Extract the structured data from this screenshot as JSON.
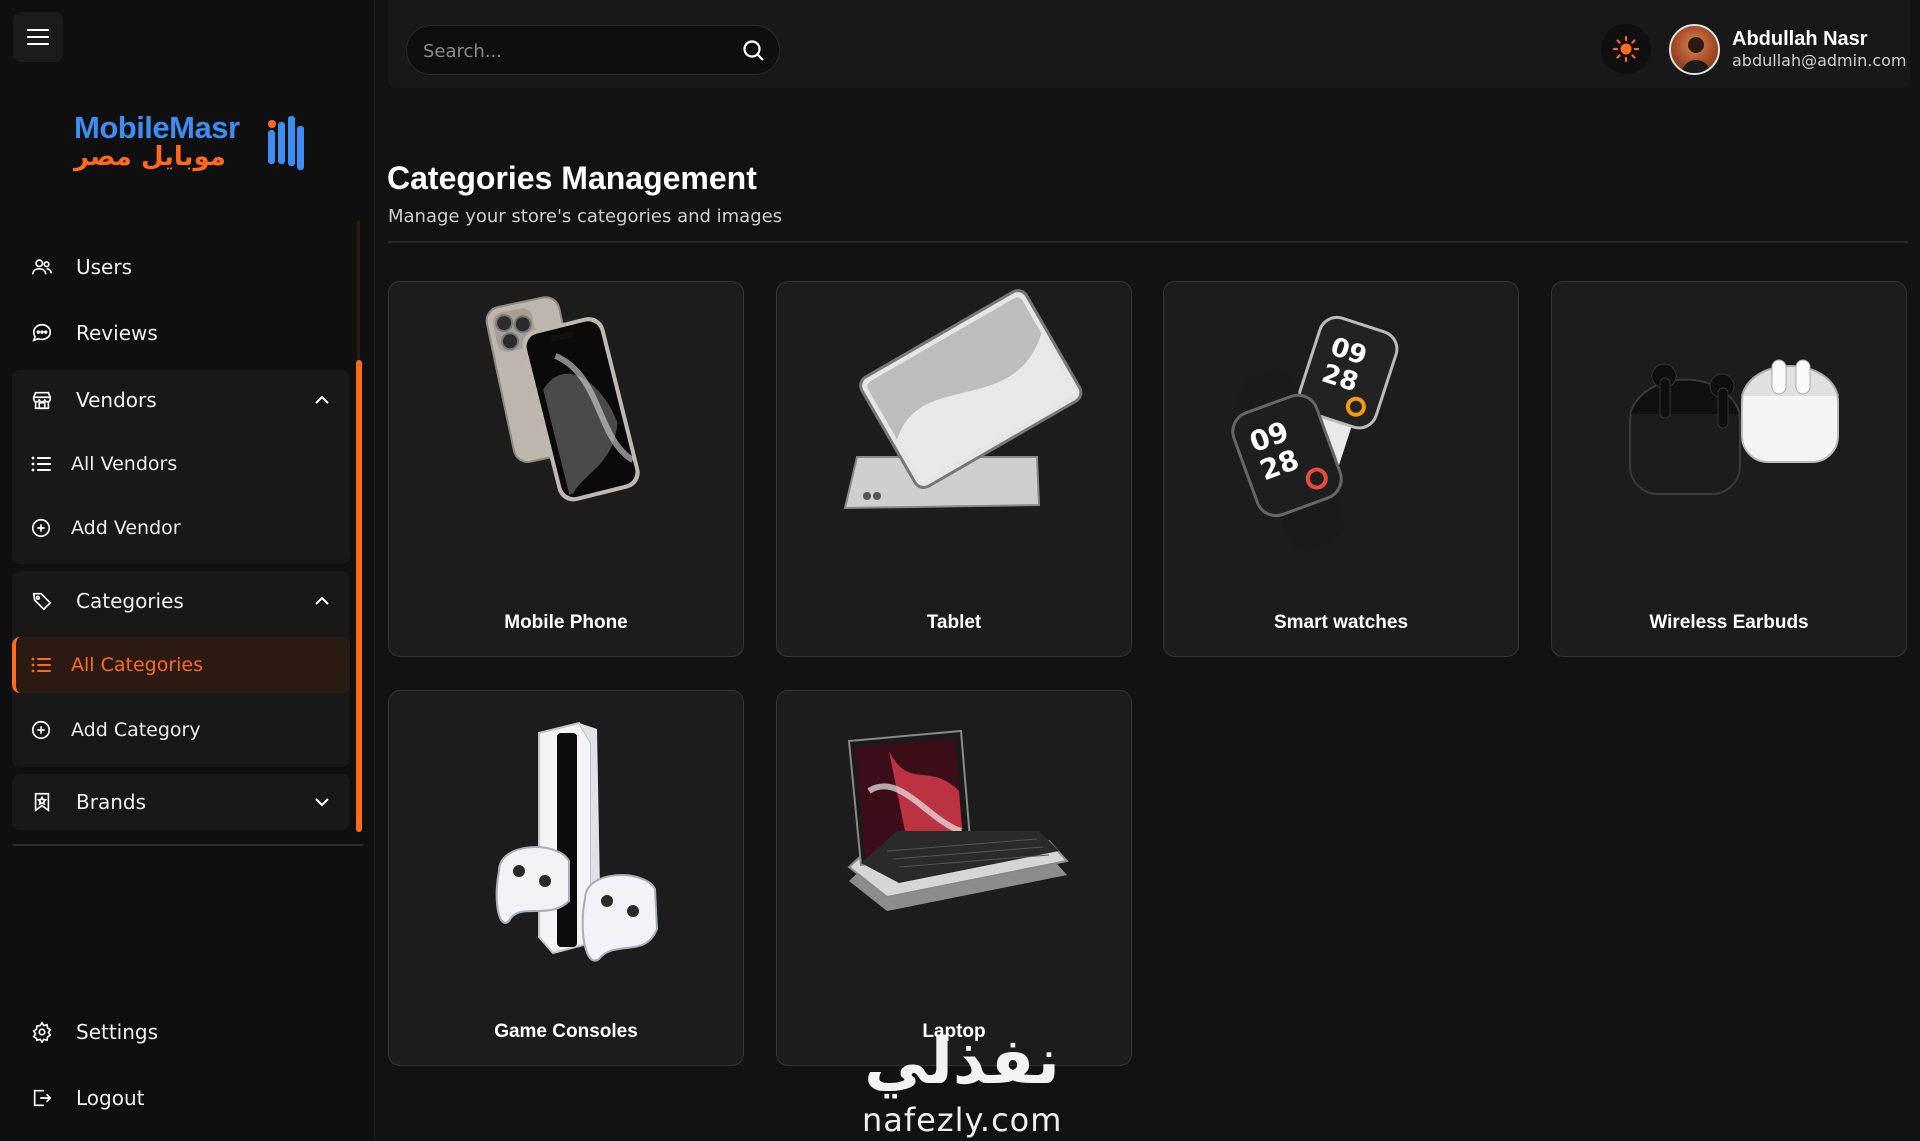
{
  "brand": {
    "name_en": "MobileMasr",
    "name_ar": "موبايل مصر",
    "accent_color": "#ff6a1a",
    "logo_blue": "#3d8df2"
  },
  "header": {
    "search_placeholder": "Search...",
    "user_name": "Abdullah Nasr",
    "user_email": "abdullah@admin.com"
  },
  "sidebar": {
    "users": "Users",
    "reviews": "Reviews",
    "vendors": "Vendors",
    "all_vendors": "All Vendors",
    "add_vendor": "Add Vendor",
    "categories": "Categories",
    "all_categories": "All Categories",
    "add_category": "Add Category",
    "brands": "Brands",
    "settings": "Settings",
    "logout": "Logout"
  },
  "page": {
    "title": "Categories Management",
    "subtitle": "Manage your store's categories and images"
  },
  "categories": [
    {
      "name": "Mobile Phone",
      "icon": "phone-image"
    },
    {
      "name": "Tablet",
      "icon": "tablet-image"
    },
    {
      "name": "Smart watches",
      "icon": "smartwatch-image"
    },
    {
      "name": "Wireless Earbuds",
      "icon": "earbuds-image"
    },
    {
      "name": "Game Consoles",
      "icon": "console-image"
    },
    {
      "name": "Laptop",
      "icon": "laptop-image"
    }
  ],
  "watermark": {
    "arabic": "نفذلي",
    "latin": "nafezly.com"
  }
}
